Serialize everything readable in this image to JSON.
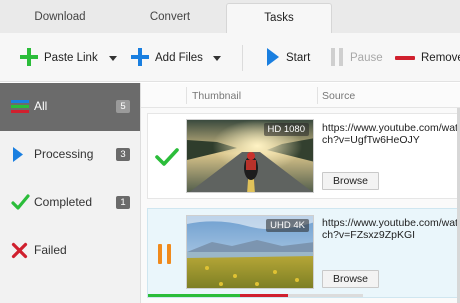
{
  "tabs": [
    {
      "label": "Download",
      "active": false
    },
    {
      "label": "Convert",
      "active": false
    },
    {
      "label": "Tasks",
      "active": true
    }
  ],
  "toolbar": {
    "paste_label": "Paste Link",
    "add_label": "Add Files",
    "start_label": "Start",
    "pause_label": "Pause",
    "remove_label": "Remove"
  },
  "sidebar": {
    "items": [
      {
        "label": "All",
        "count": "5",
        "icon": "stacked-bars-icon",
        "selected": true
      },
      {
        "label": "Processing",
        "count": "3",
        "icon": "play-triangle-icon"
      },
      {
        "label": "Completed",
        "count": "1",
        "icon": "checkmark-icon"
      },
      {
        "label": "Failed",
        "icon": "x-icon"
      }
    ]
  },
  "columns": {
    "thumbnail": "Thumbnail",
    "source": "Source"
  },
  "tasks": [
    {
      "status": "completed",
      "quality": "HD 1080",
      "url": "https://www.youtube.com/watch?v=UgfTw6HeOJY",
      "browse_label": "Browse"
    },
    {
      "status": "paused",
      "quality": "UHD 4K",
      "url": "https://www.youtube.com/watch?v=FZsxz9ZpKGI",
      "browse_label": "Browse",
      "progress_fraction": 0.65
    }
  ],
  "colors": {
    "green": "#2bbd3a",
    "blue": "#1a7fe0",
    "red": "#d0202e",
    "orange": "#f08a1c",
    "sidebar_selected": "#6b6b6b"
  }
}
